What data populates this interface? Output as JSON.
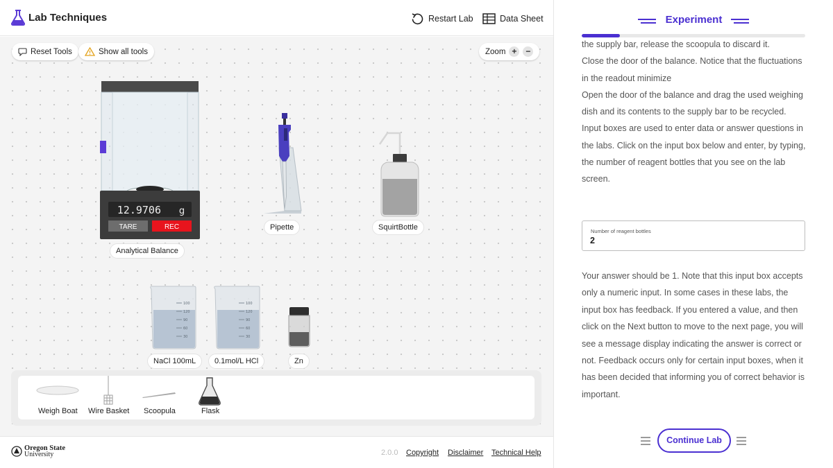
{
  "header": {
    "app_title": "Lab Techniques",
    "restart_label": "Restart Lab",
    "datasheet_label": "Data Sheet"
  },
  "toolbar": {
    "reset_label": "Reset Tools",
    "show_all_label": "Show all tools",
    "zoom_label": "Zoom"
  },
  "balance": {
    "readout": "12.9706",
    "unit": "g",
    "tare_label": "TARE",
    "rec_label": "REC",
    "name": "Analytical Balance"
  },
  "equipment": {
    "pipette": "Pipette",
    "squirt": "SquirtBottle",
    "nacl": "NaCl 100mL",
    "hcl": "0.1mol/L HCl",
    "zn": "Zn"
  },
  "beaker_ticks": [
    "100",
    "120",
    "90",
    "60",
    "30"
  ],
  "tray": {
    "items": [
      "Weigh Boat",
      "Wire Basket",
      "Scoopula",
      "Flask"
    ]
  },
  "footer": {
    "university_line1": "Oregon State",
    "university_line2": "University",
    "version": "2.0.0",
    "copyright": "Copyright",
    "disclaimer": "Disclaimer",
    "technical_help": "Technical Help"
  },
  "panel": {
    "title": "Experiment",
    "progress": 0.17,
    "paragraphs": [
      "the supply bar, release the scoopula to discard it.",
      "Close the door of the balance. Notice that the fluctuations in the readout minimize",
      "Open the door of the balance and drag the used weighing dish and its contents to the supply bar to be recycled.",
      "Input boxes are used to enter data or answer questions in the labs. Click on the input box below and enter, by typing, the number of reagent bottles that you see on the lab screen."
    ],
    "input_label": "Number of reagent bottles",
    "input_value": "2",
    "feedback": "Your answer should be 1. Note that this input box accepts only a numeric input. In some cases in these labs, the input box has feedback. If you entered a value, and then click on the Next button to move to the next page, you will see a message display indicating the answer is correct or not. Feedback occurs only for certain input boxes, when it has been decided that informing you of correct behavior is important.",
    "continue_label": "Continue Lab"
  },
  "colors": {
    "accent": "#4a2fd1",
    "rec_red": "#e8141d",
    "tare_gray": "#6d6d6d"
  }
}
